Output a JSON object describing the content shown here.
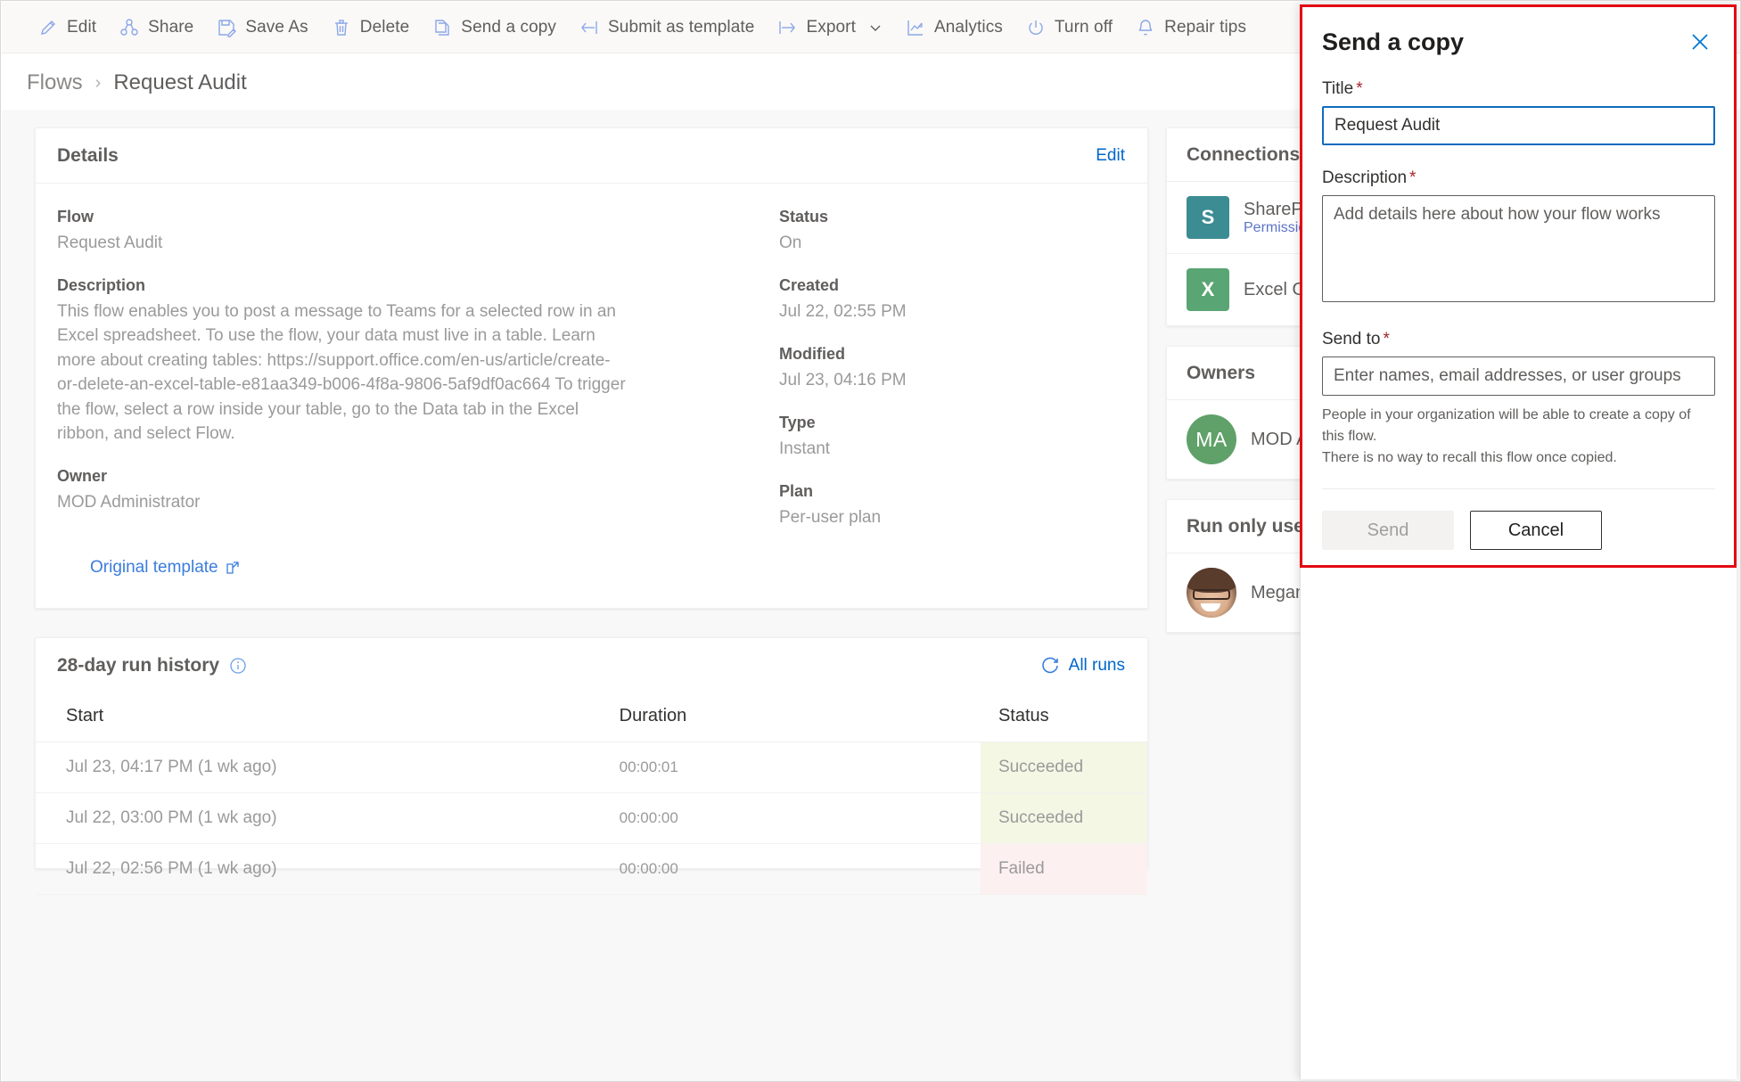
{
  "toolbar": {
    "items": [
      {
        "label": "Edit",
        "icon": "pencil-icon"
      },
      {
        "label": "Share",
        "icon": "share-icon"
      },
      {
        "label": "Save As",
        "icon": "save-as-icon"
      },
      {
        "label": "Delete",
        "icon": "trash-icon"
      },
      {
        "label": "Send a copy",
        "icon": "copy-icon"
      },
      {
        "label": "Submit as template",
        "icon": "submit-template-icon"
      },
      {
        "label": "Export",
        "icon": "export-icon",
        "has_chevron": true
      },
      {
        "label": "Analytics",
        "icon": "analytics-icon"
      },
      {
        "label": "Turn off",
        "icon": "power-icon"
      },
      {
        "label": "Repair tips",
        "icon": "bell-icon"
      }
    ]
  },
  "breadcrumb": {
    "parent": "Flows",
    "separator": "›",
    "current": "Request Audit"
  },
  "details": {
    "title": "Details",
    "edit_label": "Edit",
    "flow_label": "Flow",
    "flow_value": "Request Audit",
    "description_label": "Description",
    "description_value": "This flow enables you to post a message to Teams for a selected row in an Excel spreadsheet. To use the flow, your data must live in a table. Learn more about creating tables: https://support.office.com/en-us/article/create-or-delete-an-excel-table-e81aa349-b006-4f8a-9806-5af9df0ac664 To trigger the flow, select a row inside your table, go to the Data tab in the Excel ribbon, and select Flow.",
    "owner_label": "Owner",
    "owner_value": "MOD Administrator",
    "status_label": "Status",
    "status_value": "On",
    "created_label": "Created",
    "created_value": "Jul 22, 02:55 PM",
    "modified_label": "Modified",
    "modified_value": "Jul 23, 04:16 PM",
    "type_label": "Type",
    "type_value": "Instant",
    "plan_label": "Plan",
    "plan_value": "Per-user plan",
    "original_template_label": "Original template"
  },
  "run_history": {
    "title": "28-day run history",
    "info_icon": "info-icon",
    "all_runs_label": "All runs",
    "refresh_icon": "refresh-icon",
    "columns": [
      "Start",
      "Duration",
      "Status"
    ],
    "rows": [
      {
        "start": "Jul 23, 04:17 PM (1 wk ago)",
        "duration": "00:00:01",
        "status": "Succeeded"
      },
      {
        "start": "Jul 22, 03:00 PM (1 wk ago)",
        "duration": "00:00:00",
        "status": "Succeeded"
      },
      {
        "start": "Jul 22, 02:56 PM (1 wk ago)",
        "duration": "00:00:00",
        "status": "Failed"
      }
    ]
  },
  "rail": {
    "connections": {
      "title": "Connections",
      "items": [
        {
          "name": "SharePoint",
          "sub": "Permissions",
          "icon": "sharepoint-icon",
          "badge": "S"
        },
        {
          "name": "Excel Online (Business)",
          "sub": "",
          "icon": "excel-icon",
          "badge": "X"
        }
      ]
    },
    "owners": {
      "title": "Owners",
      "items": [
        {
          "initials": "MA",
          "name": "MOD Administrator"
        }
      ]
    },
    "run_only_users": {
      "title": "Run only users",
      "items": [
        {
          "name": "Megan Bowen",
          "avatar": "user-photo"
        }
      ]
    }
  },
  "panel": {
    "title": "Send a copy",
    "close_icon": "close-icon",
    "title_field": {
      "label": "Title",
      "required_mark": "*",
      "value": "Request Audit"
    },
    "description_field": {
      "label": "Description",
      "required_mark": "*",
      "placeholder": "Add details here about how your flow works",
      "value": ""
    },
    "send_to_field": {
      "label": "Send to",
      "required_mark": "*",
      "placeholder": "Enter names, email addresses, or user groups",
      "value": ""
    },
    "help_line1": "People in your organization will be able to create a copy of this flow.",
    "help_line2": "There is no way to recall this flow once copied.",
    "send_label": "Send",
    "cancel_label": "Cancel"
  },
  "colors": {
    "accent": "#0078d4",
    "highlight_outline": "#e30613",
    "success_bg": "#f3f7e4",
    "fail_bg": "#fdf0f0",
    "sharepoint": "#3c8c93",
    "excel": "#5aa574",
    "avatar_green": "#5fa169"
  }
}
